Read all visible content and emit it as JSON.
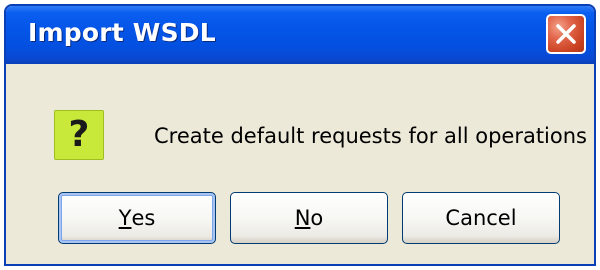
{
  "dialog": {
    "title": "Import WSDL",
    "message": "Create default requests for all operations",
    "icon": {
      "name": "question-icon",
      "glyph": "?",
      "background": "#c8e83a"
    },
    "close_icon": "close-icon",
    "buttons": {
      "yes": {
        "label": "Yes",
        "mnemonic": "Y",
        "rest": "es",
        "default": true
      },
      "no": {
        "label": "No",
        "mnemonic": "N",
        "rest": "o"
      },
      "cancel": {
        "label": "Cancel"
      }
    }
  },
  "colors": {
    "titlebar": "#0455e8",
    "close_button": "#d4502e",
    "dialog_background": "#ece9d8",
    "button_border": "#003c74"
  }
}
